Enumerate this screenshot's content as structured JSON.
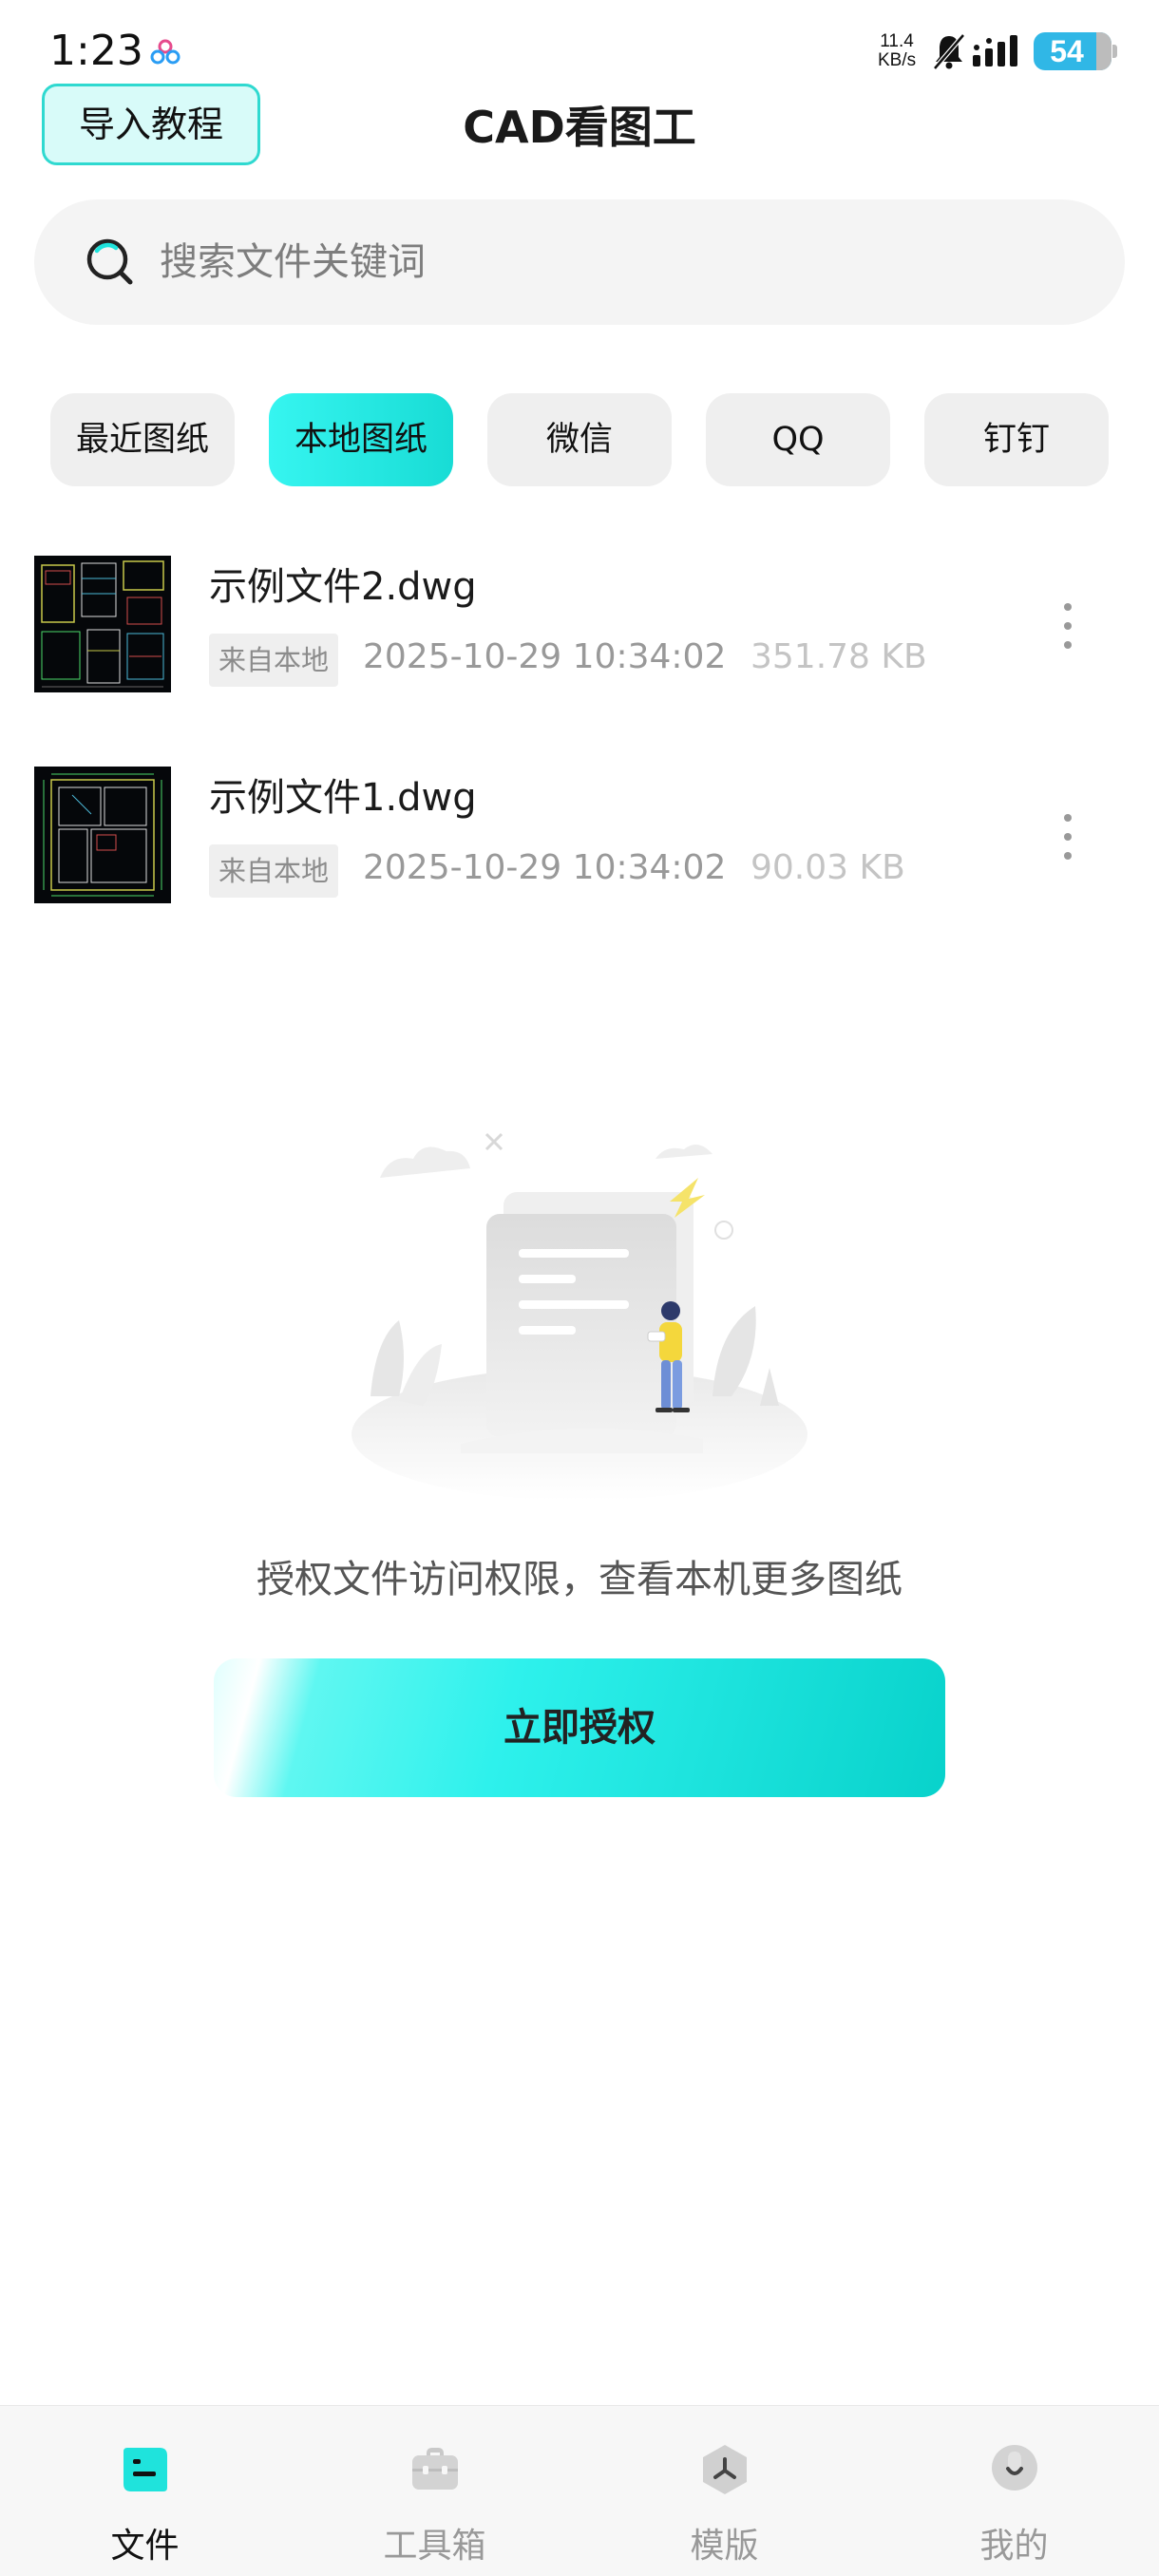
{
  "status_bar": {
    "time": "1:23",
    "net_speed_value": "11.4",
    "net_speed_unit": "KB/s",
    "battery_level": "54",
    "icons": [
      "app-notification-icon",
      "bell-muted-icon",
      "signal-icon",
      "battery-icon"
    ]
  },
  "header": {
    "import_label": "导入教程",
    "title": "CAD看图工"
  },
  "search": {
    "placeholder": "搜索文件关键词",
    "value": ""
  },
  "tabs": [
    {
      "label": "最近图纸",
      "active": false
    },
    {
      "label": "本地图纸",
      "active": true
    },
    {
      "label": "微信",
      "active": false
    },
    {
      "label": "QQ",
      "active": false
    },
    {
      "label": "钉钉",
      "active": false
    }
  ],
  "files": [
    {
      "name": "示例文件2.dwg",
      "source": "来自本地",
      "date": "2025-10-29 10:34:02",
      "size": "351.78 KB"
    },
    {
      "name": "示例文件1.dwg",
      "source": "来自本地",
      "date": "2025-10-29 10:34:02",
      "size": "90.03 KB"
    }
  ],
  "empty_state": {
    "message": "授权文件访问权限，查看本机更多图纸",
    "button_label": "立即授权"
  },
  "bottom_nav": [
    {
      "label": "文件",
      "icon": "file-icon",
      "active": true
    },
    {
      "label": "工具箱",
      "icon": "toolbox-icon",
      "active": false
    },
    {
      "label": "模版",
      "icon": "template-icon",
      "active": false
    },
    {
      "label": "我的",
      "icon": "profile-icon",
      "active": false
    }
  ],
  "colors": {
    "accent": "#1fe3dc",
    "accent_light": "#d8fbf9",
    "tab_inactive": "#efefef",
    "text_muted": "#999999"
  }
}
